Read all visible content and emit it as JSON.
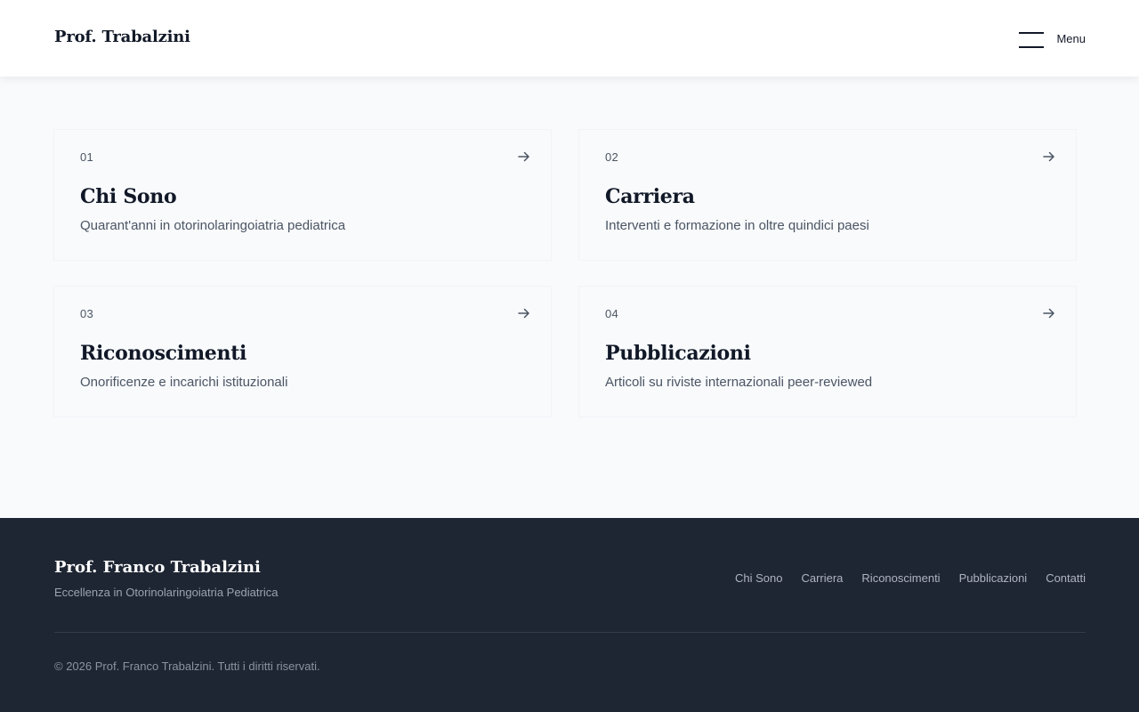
{
  "header": {
    "brand": "Prof. Trabalzini",
    "menu_label": "Menu"
  },
  "cards": [
    {
      "number": "01",
      "title": "Chi Sono",
      "description": "Quarant'anni in otorinolaringoiatria pediatrica"
    },
    {
      "number": "02",
      "title": "Carriera",
      "description": "Interventi e formazione in oltre quindici paesi"
    },
    {
      "number": "03",
      "title": "Riconoscimenti",
      "description": "Onorificenze e incarichi istituzionali"
    },
    {
      "number": "04",
      "title": "Pubblicazioni",
      "description": "Articoli su riviste internazionali peer-reviewed"
    }
  ],
  "footer": {
    "name": "Prof. Franco Trabalzini",
    "tagline": "Eccellenza in Otorinolaringoiatria Pediatrica",
    "nav": [
      "Chi Sono",
      "Carriera",
      "Riconoscimenti",
      "Pubblicazioni",
      "Contatti"
    ],
    "copyright": "© 2026 Prof. Franco Trabalzini. Tutti i diritti riservati."
  },
  "icons": {
    "menu": "hamburger-icon",
    "card_link": "arrow-right-icon"
  },
  "colors": {
    "page_background": "#f8fafc",
    "header_background": "#ffffff",
    "footer_background": "#1f2633",
    "text_primary": "#111827",
    "text_secondary": "#4b5563"
  }
}
